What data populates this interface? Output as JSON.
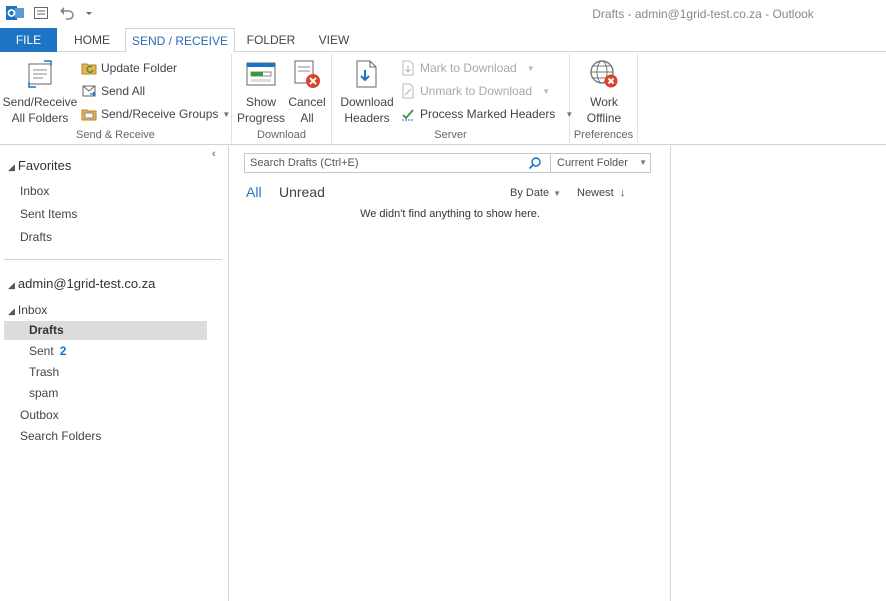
{
  "window": {
    "title": "Drafts - admin@1grid-test.co.za - Outlook"
  },
  "tabs": [
    {
      "label": "FILE"
    },
    {
      "label": "HOME"
    },
    {
      "label": "SEND / RECEIVE"
    },
    {
      "label": "FOLDER"
    },
    {
      "label": "VIEW"
    }
  ],
  "ribbon": {
    "send_receive": {
      "label": "Send & Receive",
      "all_folders_line1": "Send/Receive",
      "all_folders_line2": "All Folders",
      "update_folder": "Update Folder",
      "send_all": "Send All",
      "groups": "Send/Receive Groups"
    },
    "download": {
      "label": "Download",
      "show_progress_line1": "Show",
      "show_progress_line2": "Progress",
      "cancel_all_line1": "Cancel",
      "cancel_all_line2": "All"
    },
    "server": {
      "label": "Server",
      "download_headers_line1": "Download",
      "download_headers_line2": "Headers",
      "mark_to_download": "Mark to Download",
      "unmark_to_download": "Unmark to Download",
      "process_marked_headers": "Process Marked Headers"
    },
    "preferences": {
      "label": "Preferences",
      "work_offline_line1": "Work",
      "work_offline_line2": "Offline"
    }
  },
  "nav": {
    "favorites": {
      "header": "Favorites",
      "items": [
        "Inbox",
        "Sent Items",
        "Drafts"
      ]
    },
    "account": "admin@1grid-test.co.za",
    "inbox": "Inbox",
    "subfolders": [
      {
        "label": "Drafts",
        "selected": true
      },
      {
        "label": "Sent",
        "count": "2"
      },
      {
        "label": "Trash"
      },
      {
        "label": "spam"
      }
    ],
    "outbox": "Outbox",
    "search_folders": "Search Folders"
  },
  "list": {
    "search_placeholder": "Search Drafts (Ctrl+E)",
    "scope": "Current Folder",
    "filter_all": "All",
    "filter_unread": "Unread",
    "sort_by": "By Date",
    "sort_order": "Newest",
    "empty_message": "We didn't find anything to show here."
  },
  "colors": {
    "accent": "#1e74c4",
    "selected_bg": "#dcdcdc"
  }
}
